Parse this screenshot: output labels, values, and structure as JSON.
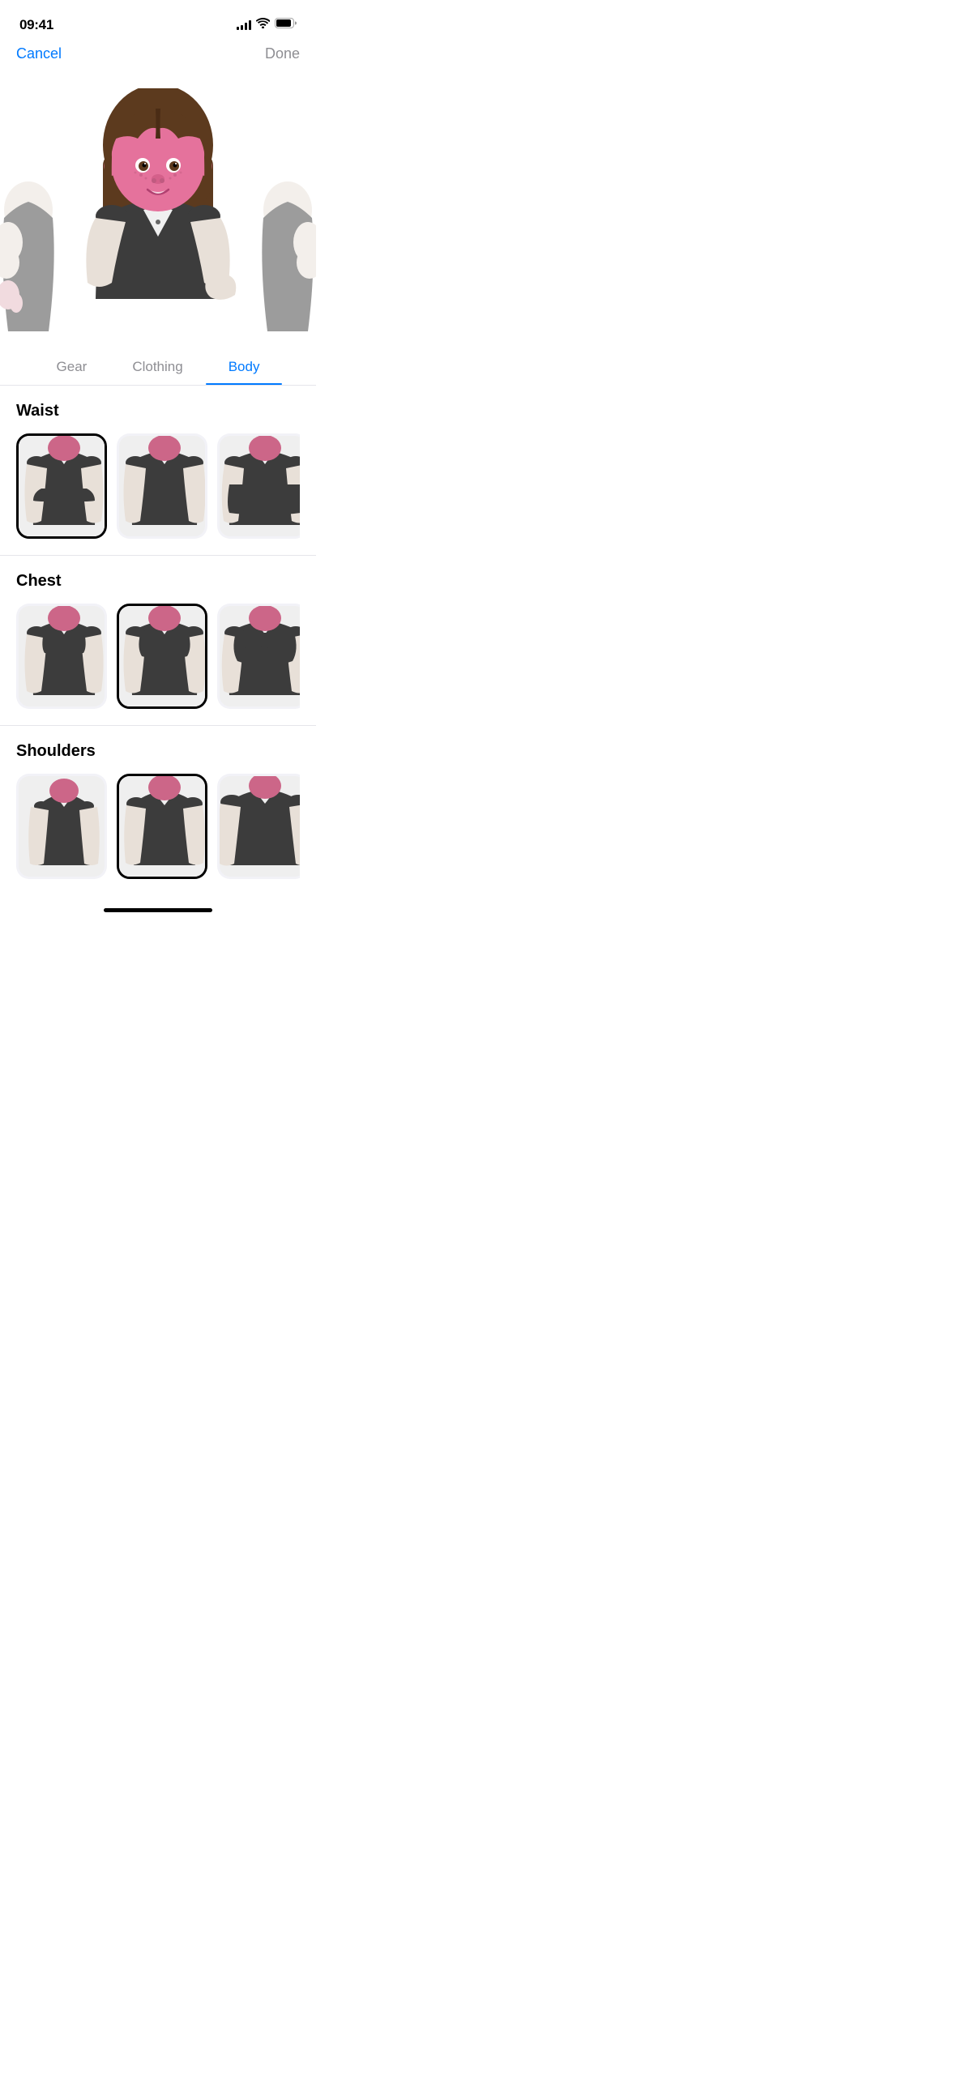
{
  "statusBar": {
    "time": "09:41",
    "signal": 4,
    "wifi": true,
    "battery": 85
  },
  "nav": {
    "cancelLabel": "Cancel",
    "doneLabel": "Done"
  },
  "tabs": [
    {
      "id": "gear",
      "label": "Gear",
      "active": false
    },
    {
      "id": "clothing",
      "label": "Clothing",
      "active": false
    },
    {
      "id": "body",
      "label": "Body",
      "active": true
    }
  ],
  "sections": [
    {
      "id": "waist",
      "title": "Waist",
      "options": [
        {
          "id": "waist-1",
          "selected": true
        },
        {
          "id": "waist-2",
          "selected": false
        },
        {
          "id": "waist-3",
          "selected": false
        }
      ]
    },
    {
      "id": "chest",
      "title": "Chest",
      "options": [
        {
          "id": "chest-1",
          "selected": false
        },
        {
          "id": "chest-2",
          "selected": true
        },
        {
          "id": "chest-3",
          "selected": false
        }
      ]
    },
    {
      "id": "shoulders",
      "title": "Shoulders",
      "options": [
        {
          "id": "shoulders-1",
          "selected": false
        },
        {
          "id": "shoulders-2",
          "selected": true
        },
        {
          "id": "shoulders-3",
          "selected": false
        }
      ]
    }
  ]
}
